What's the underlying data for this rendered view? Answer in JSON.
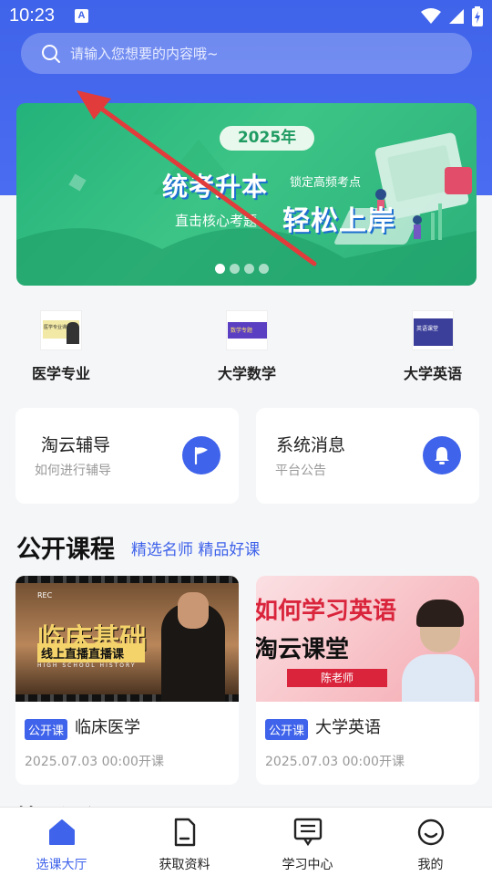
{
  "status_bar": {
    "time": "10:23",
    "a_glyph": "A"
  },
  "search": {
    "placeholder": "请输入您想要的内容哦~"
  },
  "banner": {
    "year": "2025年",
    "headline": "统考升本",
    "tagline": "锁定高频考点",
    "subline": "直击核心考题",
    "slogan": "轻松上岸",
    "slide_count": 4,
    "active_slide": 1
  },
  "categories": [
    {
      "label": "医学专业",
      "thumb_text": "医学专业课"
    },
    {
      "label": "大学数学",
      "thumb_text": "数学专题"
    },
    {
      "label": "大学英语",
      "thumb_text": "英语课堂"
    }
  ],
  "cards": [
    {
      "title": "淘云辅导",
      "subtitle": "如何进行辅导",
      "icon": "flag-icon"
    },
    {
      "title": "系统消息",
      "subtitle": "平台公告",
      "icon": "bell-icon"
    }
  ],
  "section": {
    "title": "公开课程",
    "subtitle": "精选名师 精品好课",
    "next_title": "精品课程"
  },
  "courses": [
    {
      "badge": "公开课",
      "title": "临床医学",
      "time": "2025.07.03 00:00开课",
      "cover": {
        "rec": "REC",
        "big": "临床基础",
        "small": "线上直播直播课",
        "tiny": "HIGH SCHOOL HISTORY"
      }
    },
    {
      "badge": "公开课",
      "title": "大学英语",
      "time": "2025.07.03 00:00开课",
      "cover": {
        "big1": "如何学习英语",
        "big2": "淘云课堂",
        "teacher": "陈老师"
      }
    }
  ],
  "tabs": [
    {
      "label": "选课大厅",
      "icon": "home-icon",
      "active": true
    },
    {
      "label": "获取资料",
      "icon": "document-icon",
      "active": false
    },
    {
      "label": "学习中心",
      "icon": "board-icon",
      "active": false
    },
    {
      "label": "我的",
      "icon": "smile-icon",
      "active": false
    }
  ],
  "colors": {
    "primary": "#3f63ea",
    "banner_green": "#2bb07a",
    "arrow_red": "#e23b3b"
  }
}
